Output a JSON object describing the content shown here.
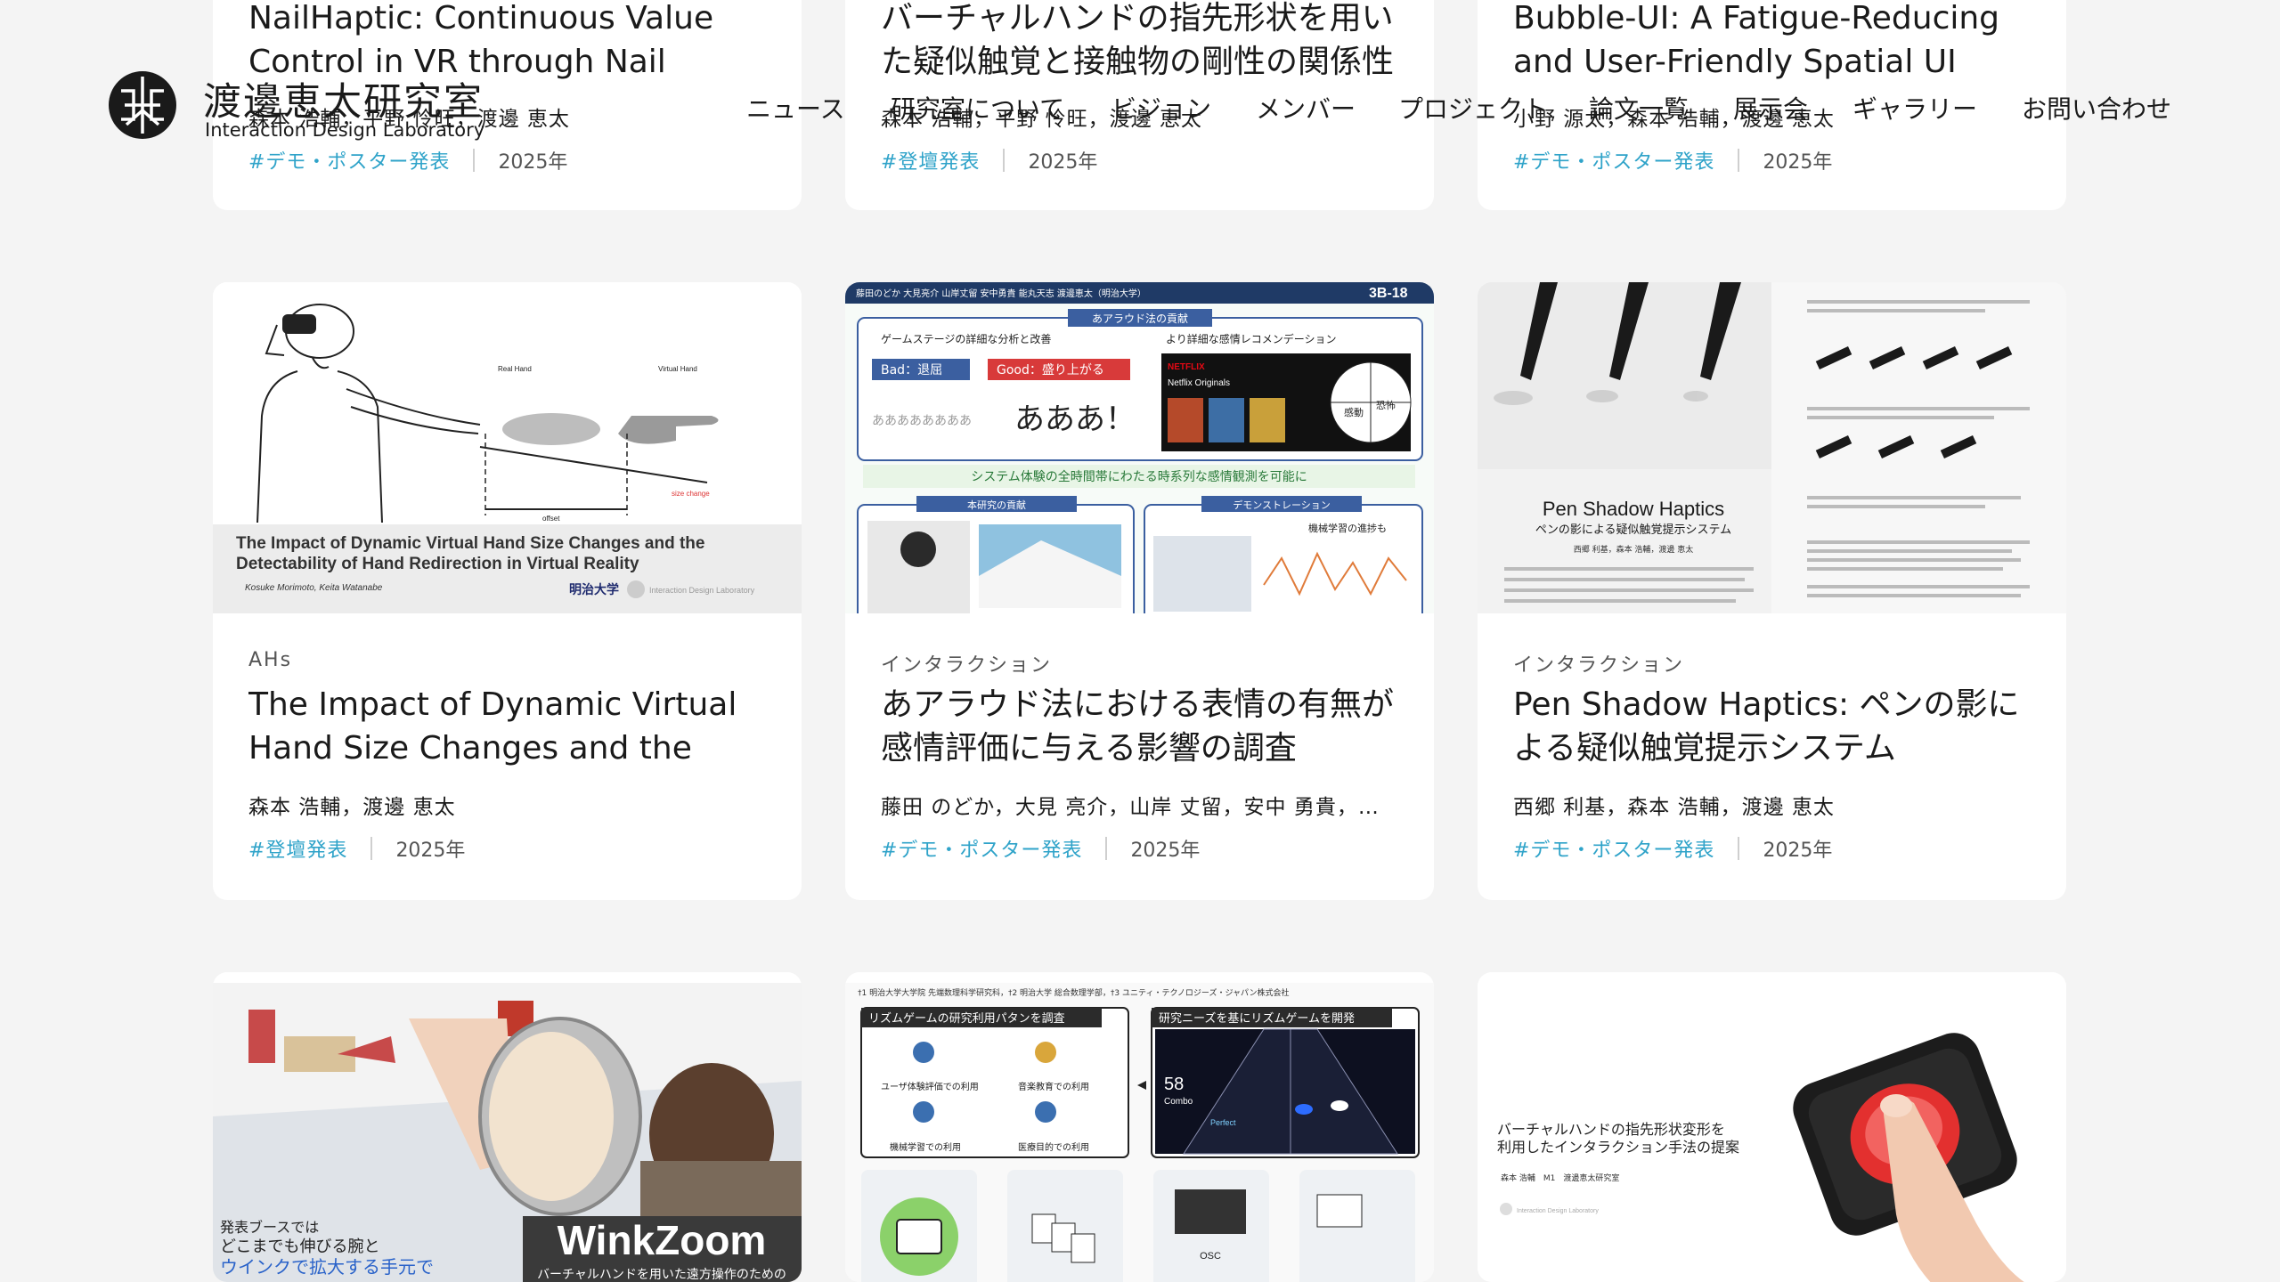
{
  "header": {
    "lab_name": "渡邊恵太研究室",
    "lab_subtitle": "Interaction Design Laboratory",
    "nav": [
      "ニュース",
      "研究室について",
      "ビジョン",
      "メンバー",
      "プロジェクト",
      "論文一覧",
      "展示会",
      "ギャラリー",
      "お問い合わせ"
    ]
  },
  "cards_row1": [
    {
      "title": "NailHaptic: Continuous Value Control in VR through Nail Color...",
      "authors": "森本 浩輔，平野 怜旺，渡邊 恵太",
      "tag": "#デモ・ポスター発表",
      "year": "2025年"
    },
    {
      "title": "バーチャルハンドの指先形状を用いた疑似触覚と接触物の剛性の関係性",
      "authors": "森本 浩輔，平野 怜旺，渡邊 恵太",
      "tag": "#登壇発表",
      "year": "2025年"
    },
    {
      "title": "Bubble-UI: A Fatigue-Reducing and User-Friendly Spatial UI System...",
      "authors": "小野 源太，森本 浩輔，渡邊 恵太",
      "tag": "#デモ・ポスター発表",
      "year": "2025年"
    }
  ],
  "cards_row2": [
    {
      "category": "AHs",
      "title": "The Impact of Dynamic Virtual Hand Size Changes and the Detectabilit...",
      "authors": "森本 浩輔，渡邊 恵太",
      "tag": "#登壇発表",
      "year": "2025年",
      "thumb": {
        "caption": "The Impact of Dynamic Virtual Hand Size Changes and the Detectability of Hand Redirection in Virtual Reality",
        "names": "Kosuke Morimoto, Keita Watanabe",
        "label_real": "Real Hand",
        "label_virtual": "Virtual Hand",
        "label_offset": "offset",
        "label_size": "size change",
        "univ": "明治大学",
        "lab": "Interaction Design Laboratory"
      }
    },
    {
      "category": "インタラクション",
      "title": "あアラウド法における表情の有無が感情評価に与える影響の調査",
      "authors": "藤田 のどか，大見 亮介，山岸 丈留，安中 勇貴，能丸 天...",
      "tag": "#デモ・ポスター発表",
      "year": "2025年",
      "thumb": {
        "top_authors": "藤田のどか 大見亮介 山岸丈留 安中勇貴 能丸天志 渡邊恵太（明治大学）",
        "code": "3B-18",
        "sec1": "あアラウド法の貢献",
        "sub1": "ゲームステージの詳細な分析と改善",
        "sub2": "より詳細な感情レコメンデーション",
        "bad": "Bad：退屈",
        "good": "Good：盛り上がる",
        "aaa": "ああああああああ",
        "big": "あああ！",
        "netflix": "NETFLIX",
        "originals": "Netflix Originals",
        "pie1": "感動",
        "pie2": "恐怖",
        "band": "システム体験の全時間帯にわたる時系列な感情観測を可能に",
        "sec2": "本研究の貢献",
        "sec3": "デモンストレーション",
        "ml": "機械学習の進捗も"
      }
    },
    {
      "category": "インタラクション",
      "title": "Pen Shadow Haptics: ペンの影による疑似触覚提示システム",
      "authors": "西郷 利基，森本 浩輔，渡邊 恵太",
      "tag": "#デモ・ポスター発表",
      "year": "2025年",
      "thumb": {
        "title": "Pen Shadow Haptics",
        "subtitle": "ペンの影による疑似触覚提示システム",
        "names": "西郷 利基，森本 浩輔，渡邊 恵太"
      }
    }
  ],
  "cards_row3": [
    {
      "thumb": {
        "line1": "発表ブースでは",
        "line2": "どこまでも伸びる腕と",
        "line3": "ウインクで拡大する手元で",
        "big": "WinkZoom",
        "sub": "バーチャルハンドを用いた遠方操作のための"
      }
    },
    {
      "thumb": {
        "affil": "†1 明治大学大学院 先端数理科学研究科，†2 明治大学 総合数理学部，†3 ユニティ・テクノロジーズ・ジャパン株式会社",
        "box1": "リズムゲームの研究利用パタンを調査",
        "box2": "研究ニーズを基にリズムゲームを開発",
        "u1": "ユーザ体験評価での利用",
        "u2": "音楽教育での利用",
        "u3": "機械学習での利用",
        "u4": "医療目的での利用",
        "combo_num": "58",
        "combo": "Combo",
        "perfect": "Perfect",
        "osc": "OSC"
      }
    },
    {
      "thumb": {
        "line1": "バーチャルハンドの指先形状変形を",
        "line2": "利用したインタラクション手法の提案",
        "names": "森本 浩輔　M1　渡邊恵太研究室",
        "lab": "Interaction Design Laboratory"
      }
    }
  ],
  "colors": {
    "tag": "#2fa3c9",
    "bg": "#f4f4f4",
    "card": "#ffffff"
  }
}
